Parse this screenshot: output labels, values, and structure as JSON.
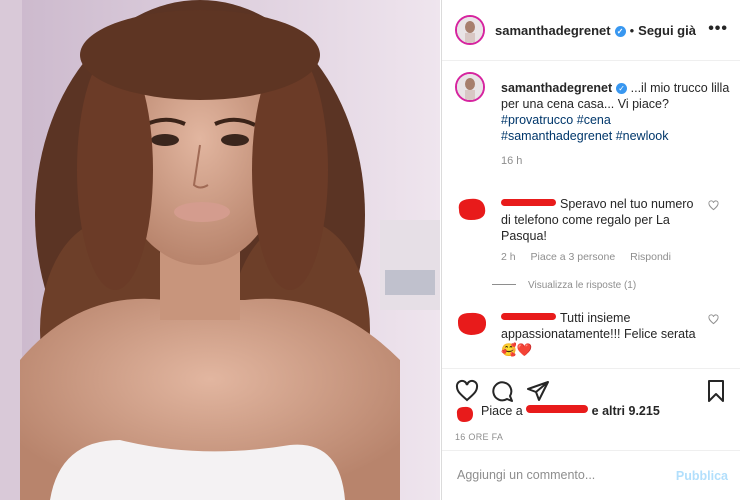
{
  "post": {
    "username": "samanthadegrenet",
    "follow_label": "Segui già",
    "more_label": "•••",
    "caption_text": "...il mio trucco lilla per una cena casa... Vi piace?",
    "hashtags": [
      "#provatrucco",
      "#cena",
      "#samanthadegrenet",
      "#newlook"
    ],
    "caption_time": "16 h"
  },
  "comments": [
    {
      "text": "Speravo nel tuo numero di telefono come regalo per La Pasqua!",
      "time": "2 h",
      "likes": "Piace a 3 persone",
      "reply_label": "Rispondi",
      "view_replies": "Visualizza le risposte (1)"
    },
    {
      "text": "Tutti insieme appassionatamente!!! Felice serata🥰❤️"
    }
  ],
  "likes": {
    "prefix": "Piace a",
    "suffix": "e altri 9.215"
  },
  "time_ago": "16 ORE FA",
  "comment_box": {
    "placeholder": "Aggiungi un commento...",
    "publish_label": "Pubblica"
  },
  "colors": {
    "link": "#00376b",
    "redaction": "#e81b1b",
    "verified": "#3897f0",
    "publish_disabled": "#b2dffc"
  }
}
